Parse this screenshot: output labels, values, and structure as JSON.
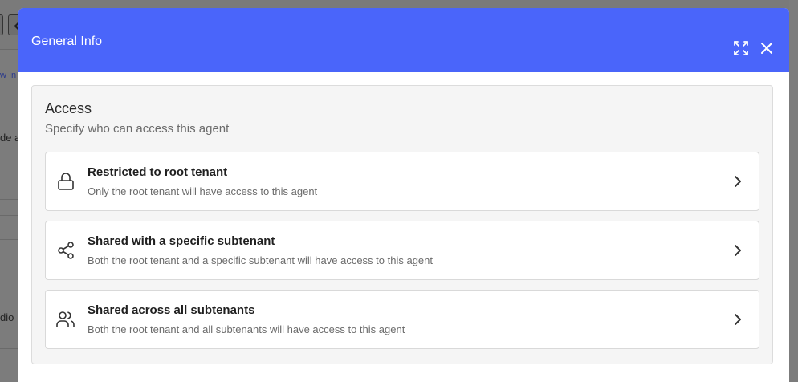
{
  "background": {
    "tab_fragment": "w In",
    "text_fragments": [
      "de a",
      "dio"
    ]
  },
  "modal": {
    "title": "General Info",
    "header_color": "#4a65fa",
    "icons": {
      "expand": "expand-icon",
      "close": "close-icon"
    }
  },
  "access": {
    "title": "Access",
    "subtitle": "Specify who can access this agent",
    "options": [
      {
        "icon": "lock-icon",
        "title": "Restricted to root tenant",
        "description": "Only the root tenant will have access to this agent"
      },
      {
        "icon": "share-icon",
        "title": "Shared with a specific subtenant",
        "description": "Both the root tenant and a specific subtenant will have access to this agent"
      },
      {
        "icon": "users-icon",
        "title": "Shared across all subtenants",
        "description": "Both the root tenant and all subtenants will have access to this agent"
      }
    ]
  }
}
